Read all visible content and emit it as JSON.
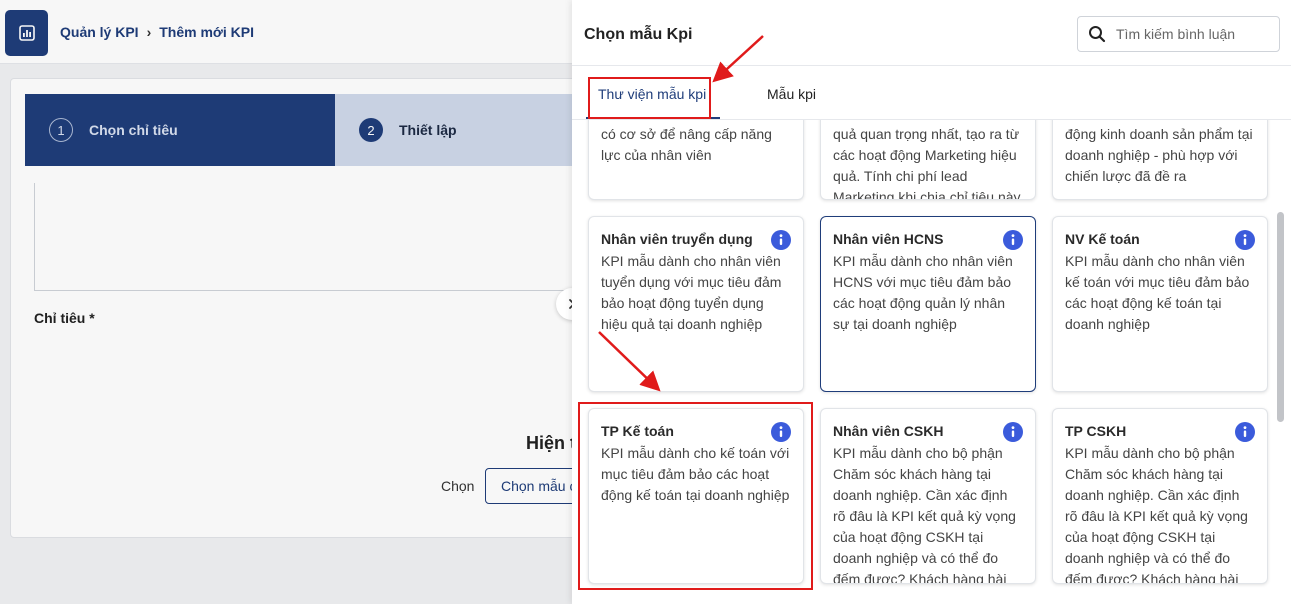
{
  "background": {
    "breadcrumb": {
      "parent": "Quản lý KPI",
      "current": "Thêm mới KPI"
    },
    "steps": [
      {
        "num": "1",
        "label": "Chọn chỉ tiêu"
      },
      {
        "num": "2",
        "label": "Thiết lập"
      }
    ],
    "chi_tieu_label": "Chỉ tiêu *",
    "hien_thi_text": "Hiện t",
    "chon_label": "Chọn",
    "chon_mau_button": "Chọn mẫu c"
  },
  "drawer": {
    "title": "Chọn mẫu Kpi",
    "search": {
      "placeholder": "Tìm kiếm bình luận"
    },
    "tabs": [
      {
        "label": "Thư viện mẫu kpi",
        "active": true
      },
      {
        "label": "Mẫu kpi",
        "active": false
      }
    ],
    "cards": [
      {
        "title": "",
        "desc": "có cơ sở để nâng cấp năng lực của nhân viên"
      },
      {
        "title": "",
        "desc": "quả quan trọng nhất, tạo ra từ các hoạt động Marketing hiệu quả. Tính chi phí lead Marketing khi chia chỉ tiêu này"
      },
      {
        "title": "",
        "desc": "động kinh doanh sản phẩm tại doanh nghiệp - phù hợp với chiến lược đã đề ra"
      },
      {
        "title": "Nhân viên truyển dụng",
        "desc": "KPI mẫu dành cho nhân viên tuyển dụng với mục tiêu đảm bảo hoạt động tuyển dụng hiệu quả tại doanh nghiệp"
      },
      {
        "title": "Nhân viên HCNS",
        "desc": "KPI mẫu dành cho nhân viên HCNS với mục tiêu đảm bảo các hoạt động quản lý nhân sự tại doanh nghiệp"
      },
      {
        "title": "NV Kế toán",
        "desc": "KPI mẫu dành cho nhân viên kế toán với mục tiêu đảm bảo các hoạt động kế toán tại doanh nghiệp"
      },
      {
        "title": "TP Kế toán",
        "desc": "KPI mẫu dành cho kế toán với mục tiêu đảm bảo các hoạt động kế toán tại doanh nghiệp"
      },
      {
        "title": "Nhân viên CSKH",
        "desc": "KPI mẫu dành cho bộ phận Chăm sóc khách hàng tại doanh nghiệp. Cần xác định rõ đâu là KPI kết quả kỳ vọng của hoạt động CSKH tại doanh nghiệp và có thể đo đếm được? Khách hàng hài lòng là"
      },
      {
        "title": "TP CSKH",
        "desc": "KPI mẫu dành cho bộ phận Chăm sóc khách hàng tại doanh nghiệp. Cần xác định rõ đâu là KPI kết quả kỳ vọng của hoạt động CSKH tại doanh nghiệp và có thể đo đếm được? Khách hàng hài lòng là"
      }
    ]
  },
  "colors": {
    "primary": "#1f3d7a",
    "info_icon": "#3b5bdb",
    "annotation_red": "#e01b1b"
  }
}
